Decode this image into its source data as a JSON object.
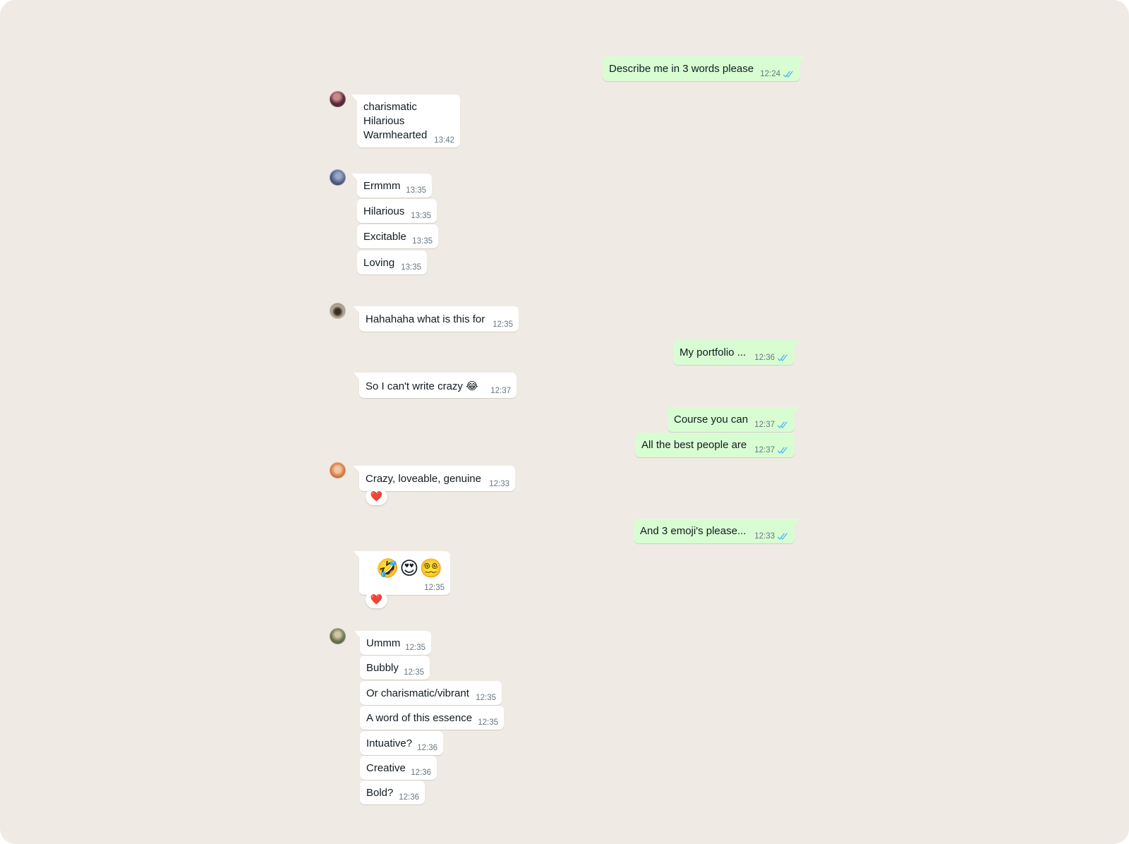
{
  "colors": {
    "background": "#efeae4",
    "incoming_bubble": "#ffffff",
    "outgoing_bubble": "#d9fdd3",
    "read_ticks": "#53bdeb",
    "timestamp": "#667781"
  },
  "messages": {
    "m1": {
      "text": "Describe me in 3 words please",
      "time": "12:24",
      "status": "read"
    },
    "m2": {
      "lines": [
        "charismatic",
        "Hilarious",
        "Warmhearted"
      ],
      "time": "13:42"
    },
    "m3": {
      "text": "Ermmm",
      "time": "13:35"
    },
    "m4": {
      "text": "Hilarious",
      "time": "13:35"
    },
    "m5": {
      "text": "Excitable",
      "time": "13:35"
    },
    "m6": {
      "text": "Loving",
      "time": "13:35"
    },
    "m7": {
      "text": "Hahahaha what is this for",
      "time": "12:35"
    },
    "m8": {
      "text": "My portfolio ...",
      "time": "12:36",
      "status": "read"
    },
    "m9": {
      "text": "So I can't write crazy",
      "emoji": "😂",
      "time": "12:37"
    },
    "m10": {
      "text": "Course you can",
      "time": "12:37",
      "status": "read"
    },
    "m11": {
      "text": "All the best people are",
      "time": "12:37",
      "status": "read"
    },
    "m12": {
      "text": "Crazy, loveable, genuine",
      "time": "12:33",
      "reaction": "❤️"
    },
    "m13": {
      "text": "And 3 emoji's please...",
      "time": "12:33",
      "status": "read"
    },
    "m14": {
      "emojis": "🤣😍😵‍💫",
      "time": "12:35",
      "reaction": "❤️"
    },
    "m15": {
      "text": "Ummm",
      "time": "12:35"
    },
    "m16": {
      "text": "Bubbly",
      "time": "12:35"
    },
    "m17": {
      "text": "Or charismatic/vibrant",
      "time": "12:35"
    },
    "m18": {
      "text": "A word of this essence",
      "time": "12:35"
    },
    "m19": {
      "text": "Intuative?",
      "time": "12:36"
    },
    "m20": {
      "text": "Creative",
      "time": "12:36"
    },
    "m21": {
      "text": "Bold?",
      "time": "12:36"
    }
  }
}
